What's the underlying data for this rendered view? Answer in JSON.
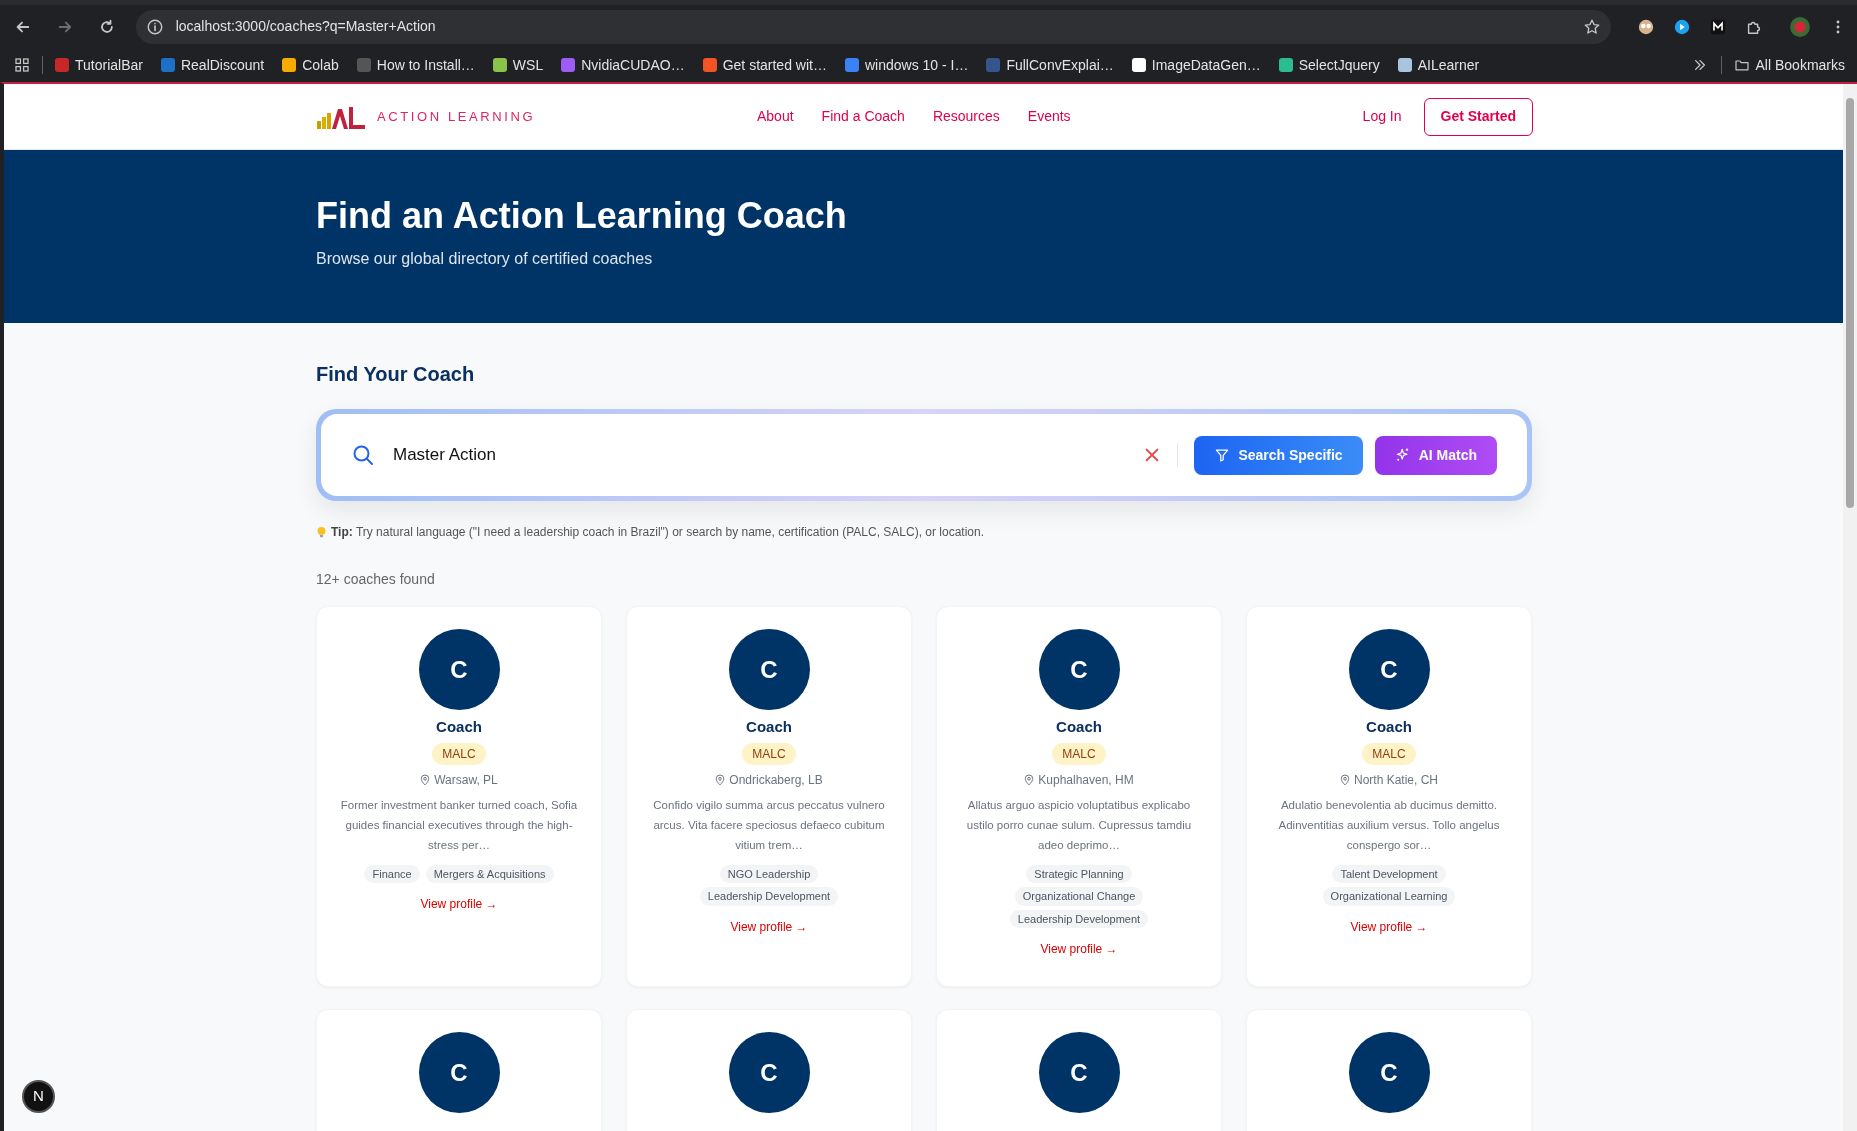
{
  "browser": {
    "url": "localhost:3000/coaches?q=Master+Action",
    "bookmarks": [
      {
        "label": "TutorialBar",
        "color": "#c62828"
      },
      {
        "label": "RealDiscount",
        "color": "#1e6fc8"
      },
      {
        "label": "Colab",
        "color": "#f9ab00"
      },
      {
        "label": "How to Install…",
        "color": "#555555"
      },
      {
        "label": "WSL",
        "color": "#8bc34a"
      },
      {
        "label": "NvidiaCUDAO…",
        "color": "#9c5cf5"
      },
      {
        "label": "Get started wit…",
        "color": "#f35325"
      },
      {
        "label": "windows 10 - I…",
        "color": "#3b82f6"
      },
      {
        "label": "FullConvExplai…",
        "color": "#34568b"
      },
      {
        "label": "ImageDataGen…",
        "color": "#ffffff"
      },
      {
        "label": "SelectJquery",
        "color": "#2bbd8e"
      },
      {
        "label": "AILearner",
        "color": "#aac4e0"
      }
    ],
    "all_bookmarks": "All Bookmarks"
  },
  "nav": {
    "brand": "ACTION LEARNING",
    "links": [
      {
        "label": "About"
      },
      {
        "label": "Find a Coach"
      },
      {
        "label": "Resources"
      },
      {
        "label": "Events"
      }
    ],
    "login": "Log In",
    "cta": "Get Started"
  },
  "hero": {
    "title": "Find an Action Learning Coach",
    "subtitle": "Browse our global directory of certified coaches"
  },
  "search": {
    "heading": "Find Your Coach",
    "value": "Master Action",
    "buttons": [
      {
        "label": "Search Specific",
        "kind": "filter"
      },
      {
        "label": "AI Match",
        "kind": "ai"
      }
    ],
    "tip_label": "Tip:",
    "tip": "Try natural language (\"I need a leadership coach in Brazil\") or search by name, certification (PALC, SALC), or location."
  },
  "results_count": "12+ coaches found",
  "cards": [
    {
      "initial": "C",
      "name": "Coach",
      "badge": "MALC",
      "location": "Warsaw, PL",
      "bio": "Former investment banker turned coach, Sofia guides financial executives through the high-stress per…",
      "tags": [
        "Finance",
        "Mergers & Acquisitions"
      ],
      "link": "View profile →"
    },
    {
      "initial": "C",
      "name": "Coach",
      "badge": "MALC",
      "location": "Ondrickaberg, LB",
      "bio": "Confido vigilo summa arcus peccatus vulnero arcus. Vita facere speciosus defaeco cubitum vitium trem…",
      "tags": [
        "NGO Leadership",
        "Leadership Development"
      ],
      "link": "View profile →"
    },
    {
      "initial": "C",
      "name": "Coach",
      "badge": "MALC",
      "location": "Kuphalhaven, HM",
      "bio": "Allatus arguo aspicio voluptatibus explicabo ustilo porro cunae sulum. Cupressus tamdiu adeo deprimo…",
      "tags": [
        "Strategic Planning",
        "Organizational Change",
        "Leadership Development"
      ],
      "link": "View profile →"
    },
    {
      "initial": "C",
      "name": "Coach",
      "badge": "MALC",
      "location": "North Katie, CH",
      "bio": "Adulatio benevolentia ab ducimus demitto. Adinventitias auxilium versus. Tollo angelus conspergo sor…",
      "tags": [
        "Talent Development",
        "Organizational Learning"
      ],
      "link": "View profile →"
    },
    {
      "initial": "C"
    },
    {
      "initial": "C"
    },
    {
      "initial": "C"
    },
    {
      "initial": "C"
    }
  ],
  "dev_badge": "N"
}
